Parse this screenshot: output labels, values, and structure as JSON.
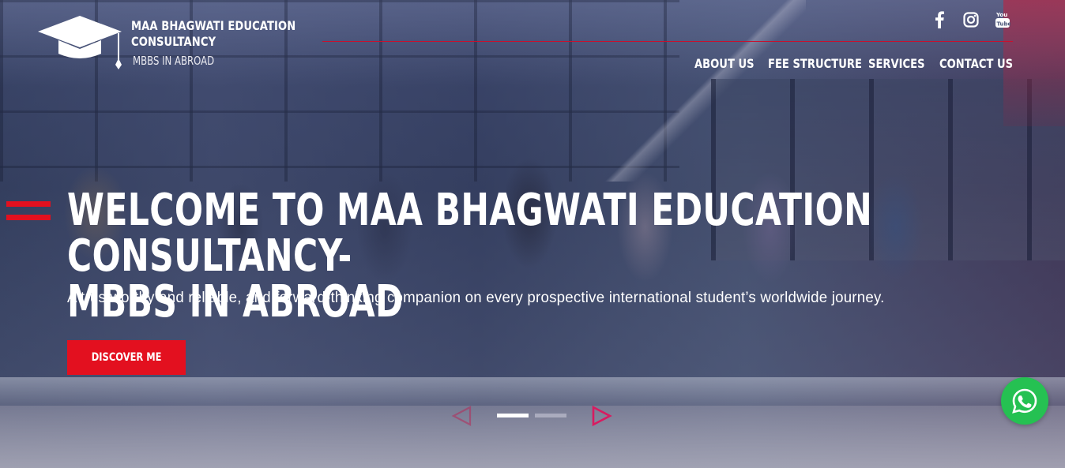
{
  "brand": {
    "name_line1": "MAA BHAGWATI EDUCATION",
    "name_line2": "CONSULTANCY",
    "tagline": "MBBS IN ABROAD",
    "icon": "graduation-cap-icon"
  },
  "social": [
    {
      "name": "facebook",
      "icon": "facebook-icon"
    },
    {
      "name": "instagram",
      "icon": "instagram-icon"
    },
    {
      "name": "youtube",
      "icon": "youtube-icon"
    }
  ],
  "nav": {
    "items": [
      {
        "label": "ABOUT US"
      },
      {
        "label": "FEE STRUCTURE"
      },
      {
        "label": "SERVICES"
      },
      {
        "label": "CONTACT US"
      }
    ]
  },
  "hero": {
    "title_line1": "WELCOME TO MAA BHAGWATI EDUCATION CONSULTANCY-",
    "title_line2": "MBBS IN ABROAD",
    "subtitle": "A trustworthy and reliable, and forward-thinking companion on every prospective international student’s worldwide journey.",
    "cta_label": "DISCOVER ME"
  },
  "slider": {
    "prev_icon": "triangle-left-icon",
    "next_icon": "triangle-right-icon",
    "slide_count": 2,
    "active_slide": 1
  },
  "floating": {
    "whatsapp_icon": "whatsapp-icon"
  },
  "colors": {
    "accent": "#e3101f",
    "whatsapp": "#25c152",
    "arrow": "#c2185b",
    "text": "#ffffff"
  }
}
